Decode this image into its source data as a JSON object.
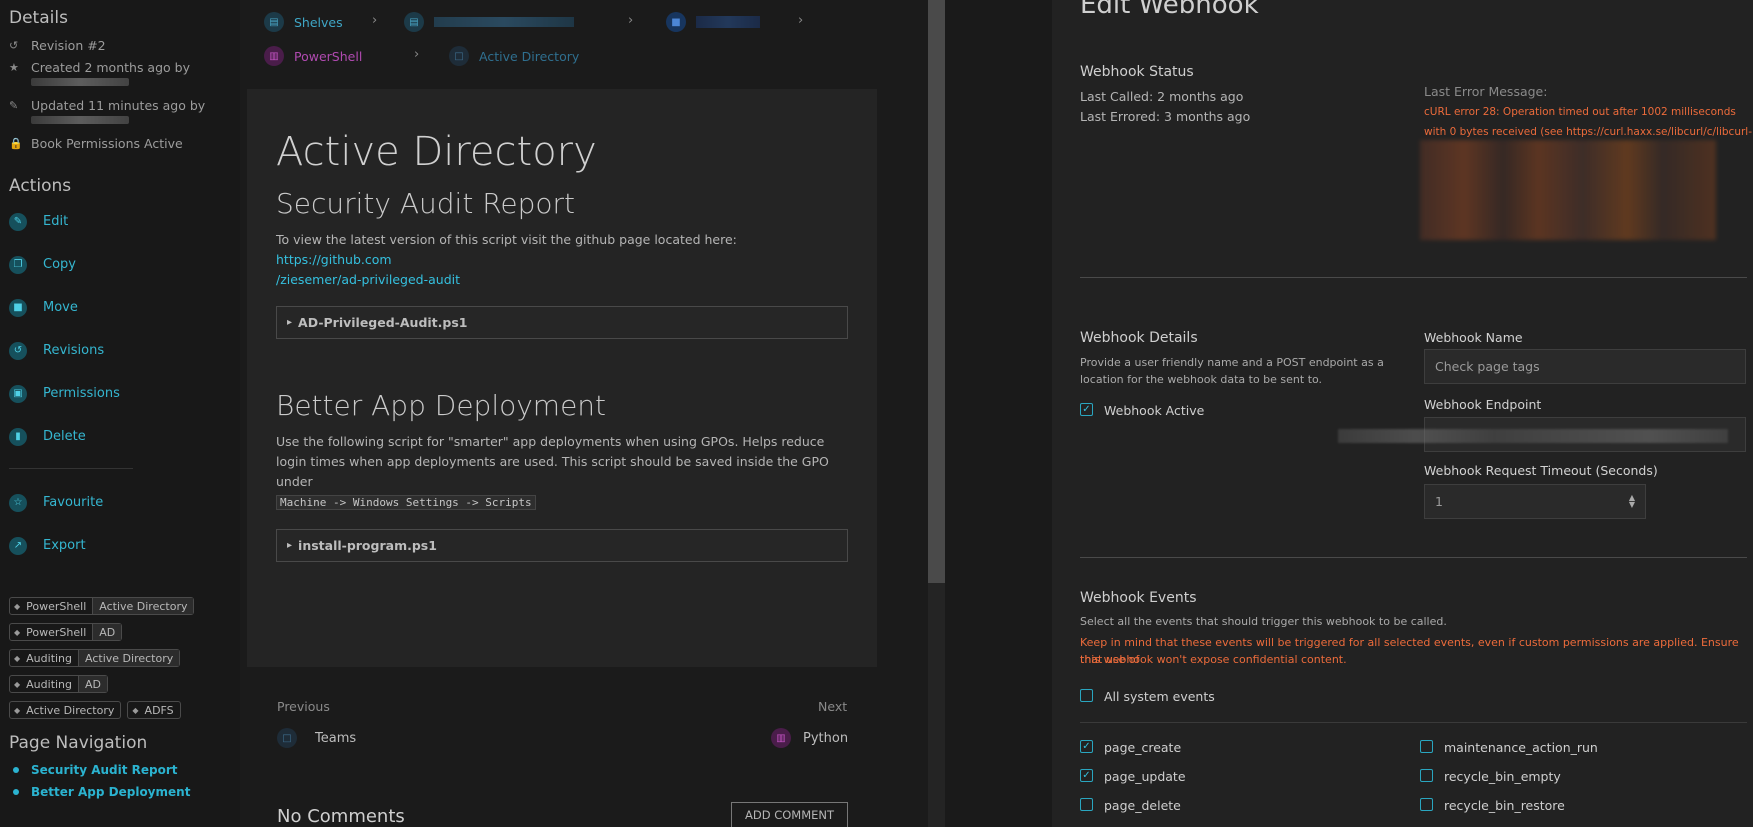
{
  "sidebar": {
    "details_title": "Details",
    "revision": "Revision #2",
    "created": "Created 2 months ago by",
    "updated": "Updated 11 minutes ago by",
    "permissions_note": "Book Permissions Active",
    "actions_title": "Actions",
    "actions": [
      {
        "label": "Edit",
        "icon": "pencil-icon"
      },
      {
        "label": "Copy",
        "icon": "copy-icon"
      },
      {
        "label": "Move",
        "icon": "folder-icon"
      },
      {
        "label": "Revisions",
        "icon": "history-icon"
      },
      {
        "label": "Permissions",
        "icon": "lock-icon"
      },
      {
        "label": "Delete",
        "icon": "trash-icon"
      }
    ],
    "extra_actions": [
      {
        "label": "Favourite",
        "icon": "star-icon"
      },
      {
        "label": "Export",
        "icon": "export-icon"
      }
    ],
    "tags": [
      {
        "name": "PowerShell",
        "value": "Active Directory"
      },
      {
        "name": "PowerShell",
        "value": "AD"
      },
      {
        "name": "Auditing",
        "value": "Active Directory"
      },
      {
        "name": "Auditing",
        "value": "AD"
      },
      {
        "name": "Active Directory",
        "value": ""
      },
      {
        "name": "ADFS",
        "value": ""
      }
    ],
    "page_nav_title": "Page Navigation",
    "page_nav": [
      "Security Audit Report",
      "Better App Deployment"
    ]
  },
  "breadcrumbs": {
    "shelves": "Shelves",
    "chapter": "PowerShell",
    "page": "Active Directory"
  },
  "page": {
    "title": "Active Directory",
    "section1_title": "Security Audit Report",
    "section1_text": "To view the latest version of this script visit the github page located here: ",
    "section1_link_a": "https://github.com",
    "section1_link_b": "/ziesemer/ad-privileged-audit",
    "section1_details": "AD-Privileged-Audit.ps1",
    "section2_title": "Better App Deployment",
    "section2_text": "Use the following script for \"smarter\" app deployments when using GPOs. Helps reduce login times when app deployments are used. This script should be saved inside the GPO under",
    "section2_code": "Machine -> Windows Settings -> Scripts",
    "section2_details": "install-program.ps1",
    "prev_label": "Previous",
    "prev_page": "Teams",
    "next_label": "Next",
    "next_page": "Python",
    "comments_title": "No Comments",
    "add_comment": "ADD COMMENT"
  },
  "webhook": {
    "title": "Edit Webhook",
    "status_title": "Webhook Status",
    "last_called": "Last Called: 2 months ago",
    "last_errored": "Last Errored: 3 months ago",
    "last_error_label": "Last Error Message:",
    "error_line1": "cURL error 28: Operation timed out after 1002 milliseconds",
    "error_line2": "with 0 bytes received (see https://curl.haxx.se/libcurl/c/libcurl-",
    "details_title": "Webhook Details",
    "details_desc1": "Provide a user friendly name and a POST endpoint as a",
    "details_desc2": "location for the webhook data to be sent to.",
    "active_label": "Webhook Active",
    "name_label": "Webhook Name",
    "name_value": "Check page tags",
    "endpoint_label": "Webhook Endpoint",
    "timeout_label": "Webhook Request Timeout (Seconds)",
    "timeout_value": "1",
    "events_title": "Webhook Events",
    "events_desc": "Select all the events that should trigger this webhook to be called.",
    "events_warning1": "Keep in mind that these events will be triggered for all selected events, even if custom permissions are applied. Ensure that use of",
    "events_warning2": "this webhook won't expose confidential content.",
    "all_events_label": "All system events",
    "events_left": [
      {
        "label": "page_create",
        "checked": true
      },
      {
        "label": "page_update",
        "checked": true
      },
      {
        "label": "page_delete",
        "checked": false
      }
    ],
    "events_right": [
      {
        "label": "maintenance_action_run",
        "checked": false
      },
      {
        "label": "recycle_bin_empty",
        "checked": false
      },
      {
        "label": "recycle_bin_restore",
        "checked": false
      }
    ]
  }
}
